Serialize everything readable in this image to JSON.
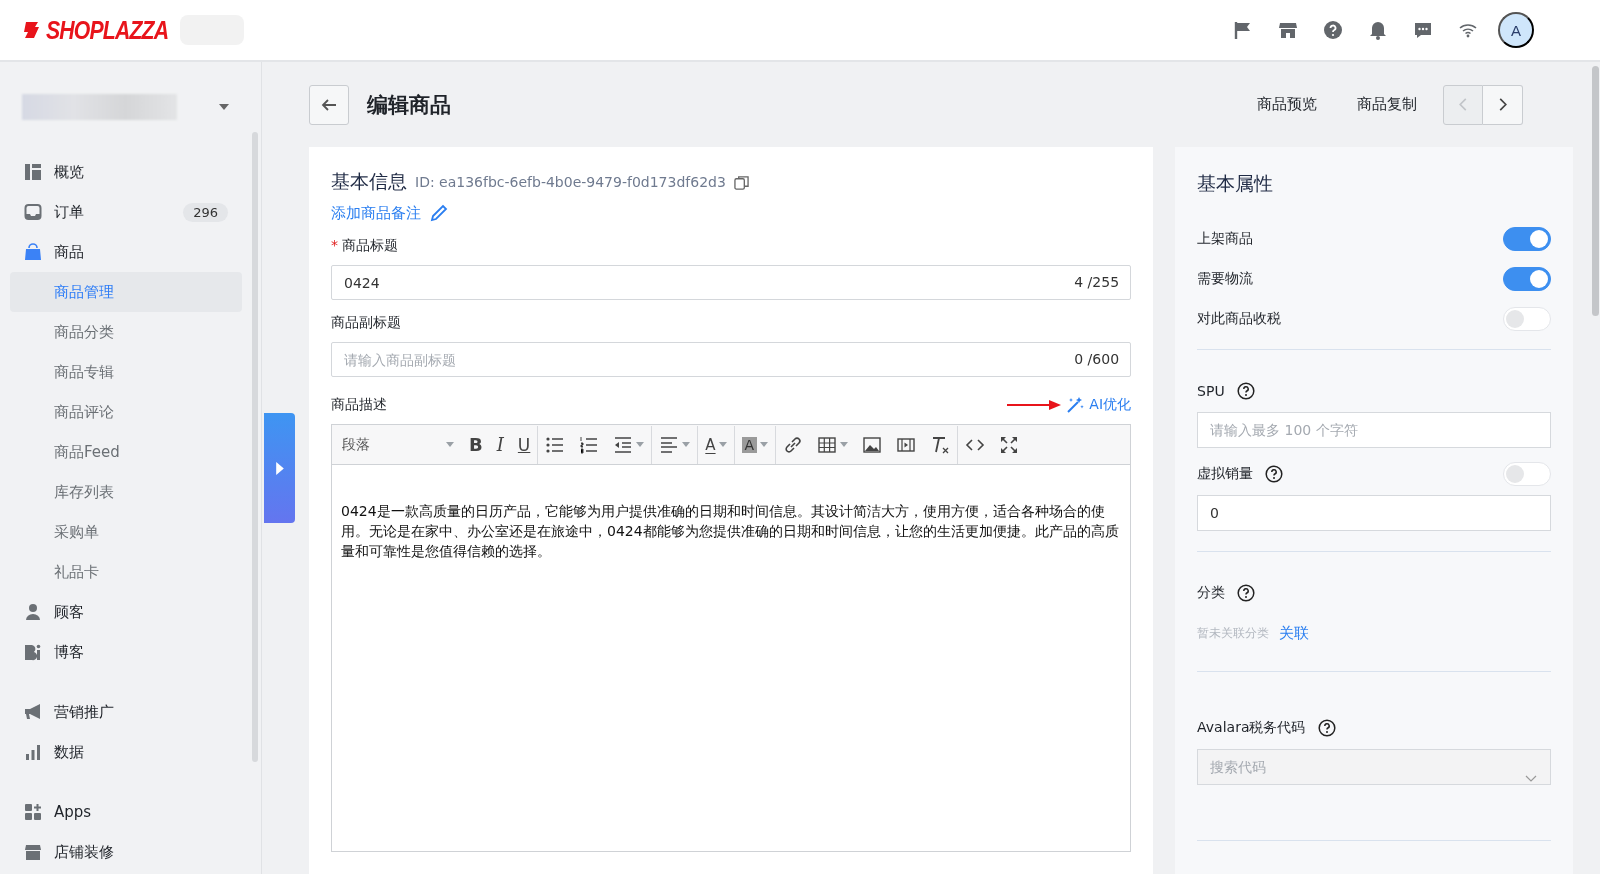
{
  "header": {
    "logo": "SHOPLAZZA",
    "avatar": "A"
  },
  "sidebar": {
    "groups": [
      [
        {
          "label": "概览",
          "selected": false
        },
        {
          "label": "订单",
          "selected": false,
          "badge": "296"
        },
        {
          "label": "商品",
          "selected": false,
          "children": [
            {
              "label": "商品管理",
              "selected": true
            },
            {
              "label": "商品分类",
              "selected": false
            },
            {
              "label": "商品专辑",
              "selected": false
            },
            {
              "label": "商品评论",
              "selected": false
            },
            {
              "label": "商品Feed",
              "selected": false
            },
            {
              "label": "库存列表",
              "selected": false
            },
            {
              "label": "采购单",
              "selected": false
            },
            {
              "label": "礼品卡",
              "selected": false
            }
          ]
        },
        {
          "label": "顾客",
          "selected": false
        },
        {
          "label": "博客",
          "selected": false
        }
      ],
      [
        {
          "label": "营销推广",
          "selected": false
        },
        {
          "label": "数据",
          "selected": false
        }
      ],
      [
        {
          "label": "Apps",
          "selected": false
        },
        {
          "label": "店铺装修",
          "selected": false
        }
      ]
    ]
  },
  "page": {
    "title": "编辑商品",
    "actions": [
      "商品预览",
      "商品复制"
    ],
    "pager": [
      {
        "kind": "prev",
        "disabled": true
      },
      {
        "kind": "next",
        "disabled": false
      }
    ]
  },
  "basic_info": {
    "title": "基本信息",
    "id_text": "ID: ea136fbc-6efb-4b0e-9479-f0d173df62d3",
    "note_link": "添加商品备注",
    "fields": [
      {
        "label": "商品标题",
        "required_mark": "*",
        "value": "0424",
        "counter": "4 /255"
      },
      {
        "label": "商品副标题",
        "placeholder": "请输入商品副标题",
        "counter": "0 /600"
      }
    ],
    "description": {
      "label": "商品描述",
      "ai_button": "AI优化",
      "toolbar": [
        {
          "kind": "dropdown",
          "label": "段落"
        },
        {
          "kind": "bold",
          "label": "B"
        },
        {
          "kind": "italic",
          "label": "I"
        },
        {
          "kind": "underline",
          "label": "U"
        },
        {
          "kind": "sep"
        },
        {
          "kind": "bullets"
        },
        {
          "kind": "numbers"
        },
        {
          "kind": "indent"
        },
        {
          "kind": "sep"
        },
        {
          "kind": "align"
        },
        {
          "kind": "sep"
        },
        {
          "kind": "color",
          "label": "A"
        },
        {
          "kind": "sep"
        },
        {
          "kind": "highlight",
          "label": "A"
        },
        {
          "kind": "sep"
        },
        {
          "kind": "link"
        },
        {
          "kind": "table"
        },
        {
          "kind": "image"
        },
        {
          "kind": "video"
        },
        {
          "kind": "clear"
        },
        {
          "kind": "sep"
        },
        {
          "kind": "code"
        },
        {
          "kind": "fullscreen"
        }
      ],
      "content": "0424是一款高质量的日历产品，它能够为用户提供准确的日期和时间信息。其设计简洁大方，使用方便，适合各种场合的使用。无论是在家中、办公室还是在旅途中，0424都能够为您提供准确的日期和时间信息，让您的生活更加便捷。此产品的高质量和可靠性是您值得信赖的选择。"
    }
  },
  "attributes": {
    "title": "基本属性",
    "toggles": [
      {
        "label": "上架商品",
        "on": true
      },
      {
        "label": "需要物流",
        "on": true
      },
      {
        "label": "对此商品收税",
        "on": false
      }
    ],
    "spu": {
      "label": "SPU",
      "placeholder": "请输入最多 100 个字符"
    },
    "virtual_sales": {
      "label": "虚拟销量",
      "on": false,
      "value": "0"
    },
    "category": {
      "label": "分类",
      "empty_text": "暂未关联分类",
      "link": "关联"
    },
    "avalara": {
      "label": "Avalara税务代码",
      "placeholder": "搜索代码"
    }
  }
}
